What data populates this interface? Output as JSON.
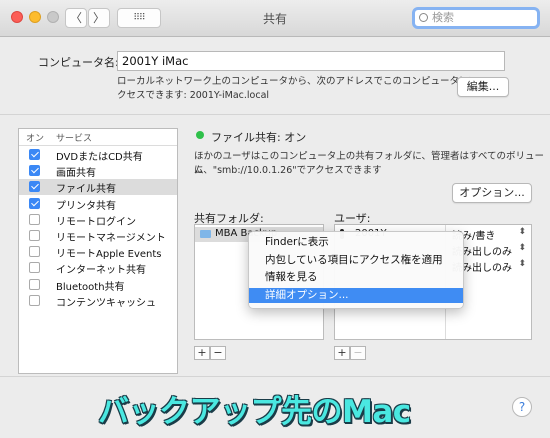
{
  "window": {
    "title": "共有"
  },
  "toolbar": {
    "back_glyph": "〈",
    "forward_glyph": "〉",
    "grid_glyph": "⠿⠿"
  },
  "search": {
    "placeholder": "検索"
  },
  "computer": {
    "label": "コンピュータ名:",
    "value": "2001Y iMac",
    "desc_line1": "ローカルネットワーク上のコンピュータから、次のアドレスでこのコンピュータにア",
    "desc_line2": "クセスできます: 2001Y-iMac.local",
    "edit_button": "編集..."
  },
  "services": {
    "col_on": "オン",
    "col_service": "サービス",
    "items": [
      {
        "name": "DVDまたはCD共有",
        "checked": true,
        "selected": false
      },
      {
        "name": "画面共有",
        "checked": true,
        "selected": false
      },
      {
        "name": "ファイル共有",
        "checked": true,
        "selected": true
      },
      {
        "name": "プリンタ共有",
        "checked": true,
        "selected": false
      },
      {
        "name": "リモートログイン",
        "checked": false,
        "selected": false
      },
      {
        "name": "リモートマネージメント",
        "checked": false,
        "selected": false
      },
      {
        "name": "リモートApple Events",
        "checked": false,
        "selected": false
      },
      {
        "name": "インターネット共有",
        "checked": false,
        "selected": false
      },
      {
        "name": "Bluetooth共有",
        "checked": false,
        "selected": false
      },
      {
        "name": "コンテンツキャッシュ",
        "checked": false,
        "selected": false
      }
    ]
  },
  "status": {
    "text": "ファイル共有: オン",
    "color": "#2fc04a",
    "desc_line1": "ほかのユーザはこのコンピュータ上の共有フォルダに、管理者はすべてのボリューム",
    "desc_line2": "に、\"smb://10.0.1.26\"でアクセスできます",
    "options_button": "オプション..."
  },
  "folders": {
    "label": "共有フォルダ:",
    "items": [
      "MBA Backup"
    ],
    "add": "+",
    "remove": "−"
  },
  "users": {
    "label": "ユーザ:",
    "items": [
      "2001Y"
    ],
    "add": "+",
    "remove": "−",
    "permissions": [
      "読み/書き",
      "読み出しのみ",
      "読み出しのみ"
    ]
  },
  "context_menu": {
    "items": [
      "Finderに表示",
      "内包している項目にアクセス権を適用",
      "情報を見る",
      "詳細オプション..."
    ],
    "highlighted": 3
  },
  "caption": "バックアップ先のMac",
  "help_glyph": "?"
}
